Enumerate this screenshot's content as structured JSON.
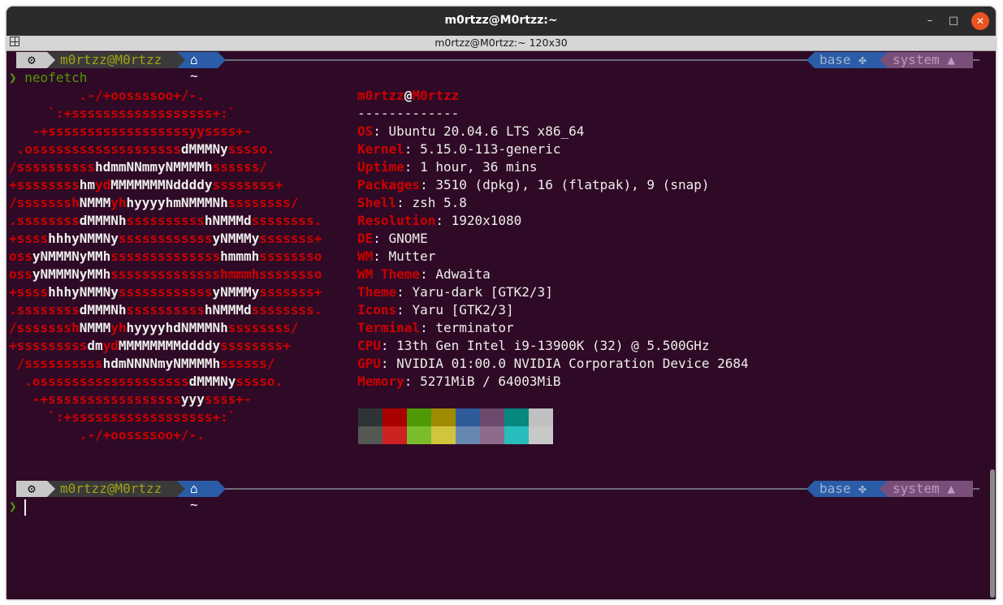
{
  "window": {
    "title": "m0rtzz@M0rtzz:~",
    "tab_title": "m0rtzz@M0rtzz:~ 120x30",
    "minimize_glyph": "–",
    "maximize_glyph": "□",
    "close_glyph": "✕"
  },
  "prompt_bar": {
    "os_icon": "ubuntu-icon",
    "user": "m0rtzz@M0rtzz",
    "dir": "~",
    "home_icon": "home-icon",
    "env_label": "base",
    "env_icon": "python-icon",
    "context_label": "system",
    "context_icon": "tower-icon"
  },
  "command": {
    "prompt_char": "❯",
    "text": "neofetch"
  },
  "logo": [
    [
      [
        "r",
        "         .-/+oossssoo+/-."
      ]
    ],
    [
      [
        "r",
        "     `:+ssssssssssssssssss+:`"
      ]
    ],
    [
      [
        "r",
        "   -+ssssssssssssssssssyyssss+-"
      ]
    ],
    [
      [
        "r",
        " .osssssssssssssssssss"
      ],
      [
        "w",
        "dMMMNy"
      ],
      [
        "r",
        "sssso."
      ]
    ],
    [
      [
        "r",
        "/ssssssssss"
      ],
      [
        "w",
        "hdmmNNmmyNMMMMh"
      ],
      [
        "r",
        "ssssss/"
      ]
    ],
    [
      [
        "r",
        "+ssssssss"
      ],
      [
        "w",
        "hm"
      ],
      [
        "r",
        "yd"
      ],
      [
        "w",
        "MMMMMMMNddddy"
      ],
      [
        "r",
        "ssssssss+"
      ]
    ],
    [
      [
        "r",
        "/sssssssh"
      ],
      [
        "w",
        "NMMM"
      ],
      [
        "r",
        "yh"
      ],
      [
        "w",
        "hyyyyhmNMMMNh"
      ],
      [
        "r",
        "ssssssss/"
      ]
    ],
    [
      [
        "r",
        ".ssssssss"
      ],
      [
        "w",
        "dMMMNh"
      ],
      [
        "r",
        "ssssssssss"
      ],
      [
        "w",
        "hNMMMd"
      ],
      [
        "r",
        "ssssssss."
      ]
    ],
    [
      [
        "r",
        "+ssss"
      ],
      [
        "w",
        "hhhyNMMNy"
      ],
      [
        "r",
        "ssssssssssss"
      ],
      [
        "w",
        "yNMMMy"
      ],
      [
        "r",
        "sssssss+"
      ]
    ],
    [
      [
        "r",
        "oss"
      ],
      [
        "w",
        "yNMMMNyMMh"
      ],
      [
        "r",
        "ssssssssssssss"
      ],
      [
        "w",
        "hmmmh"
      ],
      [
        "r",
        "ssssssso"
      ]
    ],
    [
      [
        "r",
        "oss"
      ],
      [
        "w",
        "yNMMMNyMMh"
      ],
      [
        "r",
        "sssssssssssssshmmmhssssssso"
      ]
    ],
    [
      [
        "r",
        "+ssss"
      ],
      [
        "w",
        "hhhyNMMNy"
      ],
      [
        "r",
        "ssssssssssss"
      ],
      [
        "w",
        "yNMMMy"
      ],
      [
        "r",
        "sssssss+"
      ]
    ],
    [
      [
        "r",
        ".ssssssss"
      ],
      [
        "w",
        "dMMMNh"
      ],
      [
        "r",
        "ssssssssss"
      ],
      [
        "w",
        "hNMMMd"
      ],
      [
        "r",
        "ssssssss."
      ]
    ],
    [
      [
        "r",
        "/sssssssh"
      ],
      [
        "w",
        "NMMM"
      ],
      [
        "r",
        "yh"
      ],
      [
        "w",
        "hyyyyhdNMMMNh"
      ],
      [
        "r",
        "ssssssss/"
      ]
    ],
    [
      [
        "r",
        "+sssssssss"
      ],
      [
        "w",
        "dm"
      ],
      [
        "r",
        "yd"
      ],
      [
        "w",
        "MMMMMMMMddddy"
      ],
      [
        "r",
        "ssssssss+"
      ]
    ],
    [
      [
        "r",
        " /ssssssssss"
      ],
      [
        "w",
        "hdmNNNNmyNMMMMh"
      ],
      [
        "r",
        "ssssss/"
      ]
    ],
    [
      [
        "r",
        "  .osssssssssssssssssss"
      ],
      [
        "w",
        "dMMMNy"
      ],
      [
        "r",
        "sssso."
      ]
    ],
    [
      [
        "r",
        "   -+sssssssssssssssss"
      ],
      [
        "w",
        "yyy"
      ],
      [
        "r",
        "ssss+-"
      ]
    ],
    [
      [
        "r",
        "     `:+ssssssssssssssssss+:`"
      ]
    ],
    [
      [
        "r",
        "         .-/+oossssoo+/-."
      ]
    ]
  ],
  "info": {
    "user": "m0rtzz",
    "at": "@",
    "host": "M0rtzz",
    "separator": "-------------",
    "rows": [
      {
        "key": "OS",
        "value": "Ubuntu 20.04.6 LTS x86_64"
      },
      {
        "key": "Kernel",
        "value": "5.15.0-113-generic"
      },
      {
        "key": "Uptime",
        "value": "1 hour, 36 mins"
      },
      {
        "key": "Packages",
        "value": "3510 (dpkg), 16 (flatpak), 9 (snap)"
      },
      {
        "key": "Shell",
        "value": "zsh 5.8"
      },
      {
        "key": "Resolution",
        "value": "1920x1080"
      },
      {
        "key": "DE",
        "value": "GNOME"
      },
      {
        "key": "WM",
        "value": "Mutter"
      },
      {
        "key": "WM Theme",
        "value": "Adwaita"
      },
      {
        "key": "Theme",
        "value": "Yaru-dark [GTK2/3]"
      },
      {
        "key": "Icons",
        "value": "Yaru [GTK2/3]"
      },
      {
        "key": "Terminal",
        "value": "terminator"
      },
      {
        "key": "CPU",
        "value": "13th Gen Intel i9-13900K (32) @ 5.500GHz"
      },
      {
        "key": "GPU",
        "value": "NVIDIA 01:00.0 NVIDIA Corporation Device 2684"
      },
      {
        "key": "Memory",
        "value": "5271MiB / 64003MiB"
      }
    ]
  },
  "palette": {
    "normal": [
      "#2e3436",
      "#aa0000",
      "#4e9a06",
      "#a08a00",
      "#2e5b9a",
      "#6d4a6d",
      "#06877f",
      "#c0c0c0"
    ],
    "bright": [
      "#555753",
      "#cc2222",
      "#79bd2b",
      "#d2c53d",
      "#6688b0",
      "#8d6b8d",
      "#27bdbc",
      "#c8c8c8"
    ]
  },
  "colors": {
    "background": "#2f0a26",
    "accent_red": "#cc0000",
    "prompt_green": "#4e9a06",
    "user_yellow": "#a3a017"
  }
}
